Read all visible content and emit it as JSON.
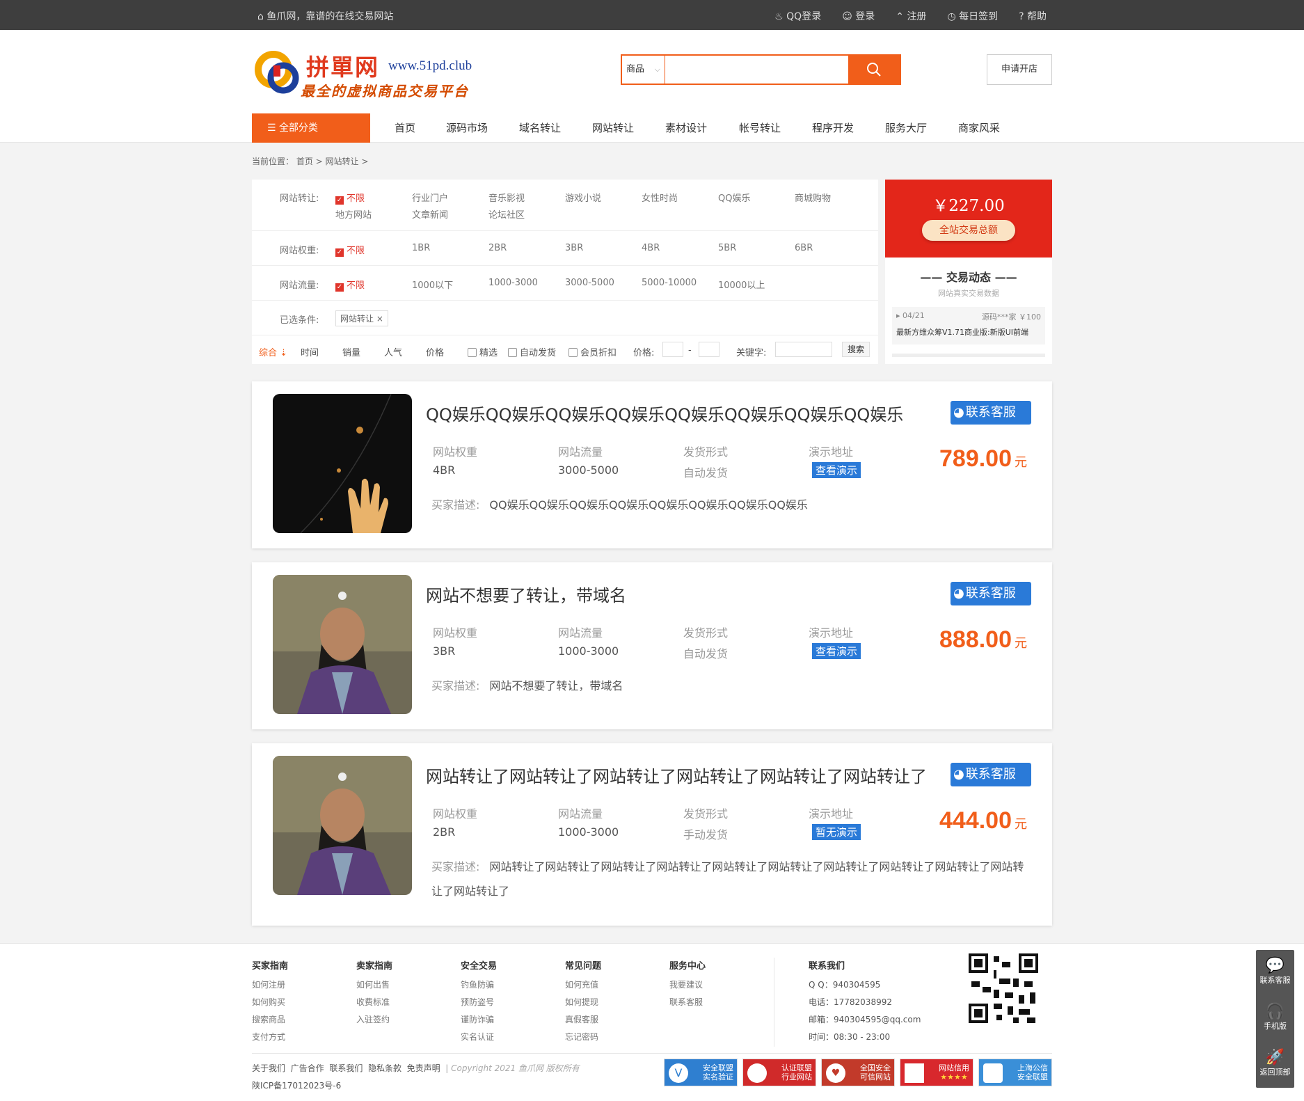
{
  "topbar": {
    "slogan": "鱼爪网，靠谱的在线交易网站",
    "links": [
      "QQ登录",
      "登录",
      "注册",
      "每日签到",
      "帮助"
    ]
  },
  "header": {
    "logo_main": "拼單网",
    "logo_url": "www.51pd.club",
    "logo_sub": "最全的虚拟商品交易平台",
    "search_category": "商品",
    "search_placeholder": "",
    "open_shop": "申请开店"
  },
  "nav": {
    "all": "全部分类",
    "items": [
      "首页",
      "源码市场",
      "域名转让",
      "网站转让",
      "素材设计",
      "帐号转让",
      "程序开发",
      "服务大厅",
      "商家风采"
    ]
  },
  "breadcrumb": "当前位置： 首页 > 网站转让 >",
  "filter": {
    "row1": {
      "label": "网站转让:",
      "selected": "不限",
      "options": [
        "行业门户",
        "音乐影视",
        "游戏小说",
        "女性时尚",
        "QQ娱乐",
        "商城购物"
      ],
      "options2": [
        "地方网站",
        "文章新闻",
        "论坛社区"
      ]
    },
    "row2": {
      "label": "网站权重:",
      "selected": "不限",
      "options": [
        "1BR",
        "2BR",
        "3BR",
        "4BR",
        "5BR",
        "6BR"
      ]
    },
    "row3": {
      "label": "网站流量:",
      "selected": "不限",
      "options": [
        "1000以下",
        "1000-3000",
        "3000-5000",
        "5000-10000",
        "10000以上"
      ]
    },
    "row4": {
      "label": "已选条件:",
      "tag": "网站转让 ×"
    },
    "sort": {
      "items": [
        "综合",
        "时间",
        "销量",
        "人气",
        "价格"
      ],
      "checks": [
        "精选",
        "自动发货",
        "会员折扣"
      ],
      "price_label": "价格:",
      "dash": "-",
      "keyword_label": "关键字:",
      "search": "搜索"
    }
  },
  "side": {
    "total": "￥227.00",
    "total_label": "全站交易总额",
    "title": "交易动态",
    "subtitle": "网站真实交易数据",
    "feed_date": "04/21",
    "feed_user": "源码***家",
    "feed_amount": "￥100",
    "feed_item": "最新方维众筹V1.71商业版:新版UI前端"
  },
  "labels": {
    "weight": "网站权重",
    "traffic": "网站流量",
    "delivery": "发货形式",
    "demo": "演示地址",
    "desc": "买家描述:",
    "cs": "联系客服",
    "yuan": "元"
  },
  "listings": [
    {
      "title": "QQ娱乐QQ娱乐QQ娱乐QQ娱乐QQ娱乐QQ娱乐QQ娱乐QQ娱乐",
      "weight": "4BR",
      "traffic": "3000-5000",
      "delivery": "自动发货",
      "demo": "查看演示",
      "price": "789.00",
      "desc": "QQ娱乐QQ娱乐QQ娱乐QQ娱乐QQ娱乐QQ娱乐QQ娱乐QQ娱乐"
    },
    {
      "title": "网站不想要了转让，带域名",
      "weight": "3BR",
      "traffic": "1000-3000",
      "delivery": "自动发货",
      "demo": "查看演示",
      "price": "888.00",
      "desc": "网站不想要了转让，带域名"
    },
    {
      "title": "网站转让了网站转让了网站转让了网站转让了网站转让了网站转让了",
      "weight": "2BR",
      "traffic": "1000-3000",
      "delivery": "手动发货",
      "demo": "暂无演示",
      "price": "444.00",
      "desc": "网站转让了网站转让了网站转让了网站转让了网站转让了网站转让了网站转让了网站转让了网站转让了网站转让了网站转让了"
    }
  ],
  "footer": {
    "cols": [
      {
        "title": "买家指南",
        "items": [
          "如何注册",
          "如何购买",
          "搜索商品",
          "支付方式"
        ]
      },
      {
        "title": "卖家指南",
        "items": [
          "如何出售",
          "收费标准",
          "入驻签约"
        ]
      },
      {
        "title": "安全交易",
        "items": [
          "钓鱼防骗",
          "预防盗号",
          "谨防诈骗",
          "实名认证"
        ]
      },
      {
        "title": "常见问题",
        "items": [
          "如何充值",
          "如何提现",
          "真假客服",
          "忘记密码"
        ]
      },
      {
        "title": "服务中心",
        "items": [
          "我要建议",
          "联系客服"
        ]
      }
    ],
    "contact": {
      "title": "联系我们",
      "qq": "Q Q：940304595",
      "phone": "电话：17782038992",
      "email": "邮箱：940304595@qq.com",
      "hours": "时间：08:30 - 23:00"
    },
    "links": [
      "关于我们",
      "广告合作",
      "联系我们",
      "隐私条款",
      "免责声明"
    ],
    "copyright": "| Copyright 2021 鱼爪网 版权所有",
    "icp": "陕ICP备17012023号-6",
    "badges": [
      {
        "t1": "安全联盟",
        "t2": "实名验证",
        "color": "#2f7fd0"
      },
      {
        "t1": "认证联盟",
        "t2": "行业网站",
        "color": "#d02a2a"
      },
      {
        "t1": "全国安全",
        "t2": "可信网站",
        "color": "#c23a2a"
      },
      {
        "t1": "网站信用",
        "t2": "★★★★",
        "color": "#d8282d"
      },
      {
        "t1": "上海公信",
        "t2": "安全联盟",
        "color": "#3a8fd8"
      }
    ]
  },
  "float": [
    "联系客服",
    "手机版",
    "返回顶部"
  ]
}
